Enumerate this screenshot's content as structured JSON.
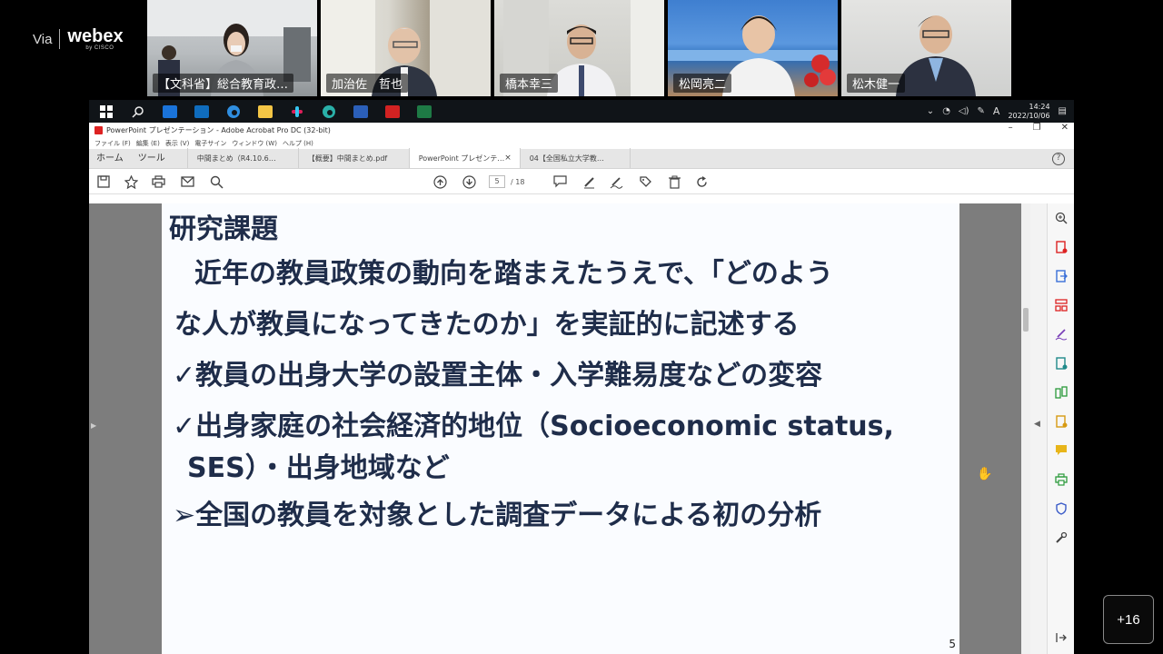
{
  "webex": {
    "via": "Via",
    "brand": "webex",
    "by": "by CISCO"
  },
  "participants": [
    {
      "name": "【文科省】総合教育政…"
    },
    {
      "name": "加治佐　哲也"
    },
    {
      "name": "橋本幸三"
    },
    {
      "name": "松岡亮二"
    },
    {
      "name": "松木健一"
    }
  ],
  "more_participants": "+16",
  "taskbar": {
    "icons": [
      "windows-icon",
      "search-icon",
      "box-icon",
      "outlook-icon",
      "edge-icon",
      "file-explorer-icon",
      "slack-icon",
      "edge-beta-icon",
      "word-icon",
      "acrobat-icon",
      "excel-icon"
    ],
    "time": "14:24",
    "date": "2022/10/06",
    "ime": "A"
  },
  "window": {
    "title": "PowerPoint プレゼンテーション - Adobe Acrobat Pro DC (32-bit)",
    "menu": [
      "ファイル (F)",
      "編集 (E)",
      "表示 (V)",
      "電子サイン",
      "ウィンドウ (W)",
      "ヘルプ (H)"
    ]
  },
  "tabs": {
    "home": "ホーム",
    "tools": "ツール",
    "documents": [
      {
        "label": "中間まとめ（R4.10.6…",
        "active": false
      },
      {
        "label": "【概要】中間まとめ.pdf",
        "active": false
      },
      {
        "label": "PowerPoint プレゼンテ…",
        "active": true
      },
      {
        "label": "04【全国私立大学教…",
        "active": false
      }
    ],
    "close": "×",
    "help": "?"
  },
  "toolbar": {
    "current_page": "5",
    "total_pages": "/ 18"
  },
  "slide": {
    "heading": "研究課題",
    "lines": [
      "近年の教員政策の動向を踏まえたうえで、「どのよう",
      "な人が教員になってきたのか」を実証的に記述する",
      "✓教員の出身大学の設置主体・入学難易度などの変容",
      "✓出身家庭の社会経済的地位（Socioeconomic status,",
      "SES）・出身地域など",
      "➢全国の教員を対象とした調査データによる初の分析"
    ],
    "page_number": "5"
  },
  "colors": {
    "slide_text": "#1f2d4a",
    "taskbar": "#101418",
    "acrobat_red": "#d22222"
  }
}
